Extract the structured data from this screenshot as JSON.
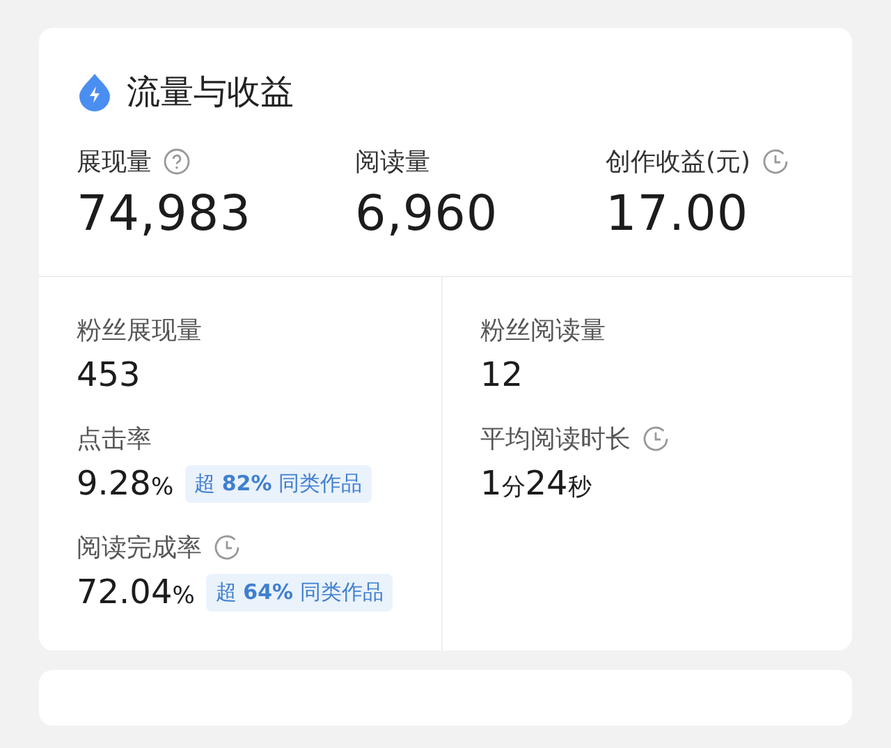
{
  "card": {
    "title": "流量与收益",
    "main_stats": [
      {
        "kind": "help",
        "label": "展现量",
        "value": "74,983"
      },
      {
        "kind": "plain",
        "label": "阅读量",
        "value": "6,960"
      },
      {
        "kind": "clock",
        "label": "创作收益(元)",
        "value": "17.00"
      }
    ],
    "columns": [
      [
        {
          "kind": "plain",
          "label": "粉丝展现量",
          "value": [
            {
              "kind": "num",
              "text": "453"
            }
          ]
        },
        {
          "kind": "plain",
          "label": "点击率",
          "value": [
            {
              "kind": "num",
              "text": "9.28"
            },
            {
              "kind": "unit",
              "text": "%"
            }
          ],
          "badge": "超 **82%** 同类作品"
        },
        {
          "kind": "clock",
          "label": "阅读完成率",
          "value": [
            {
              "kind": "num",
              "text": "72.04"
            },
            {
              "kind": "unit",
              "text": "%"
            }
          ],
          "badge": "超 **64%** 同类作品"
        }
      ],
      [
        {
          "kind": "plain",
          "label": "粉丝阅读量",
          "value": [
            {
              "kind": "num",
              "text": "12"
            }
          ]
        },
        {
          "kind": "clock",
          "label": "平均阅读时长",
          "value": [
            {
              "kind": "num",
              "text": "1"
            },
            {
              "kind": "unit",
              "text": "分"
            },
            {
              "kind": "num",
              "text": "24"
            },
            {
              "kind": "unit",
              "text": "秒"
            }
          ]
        }
      ]
    ]
  }
}
